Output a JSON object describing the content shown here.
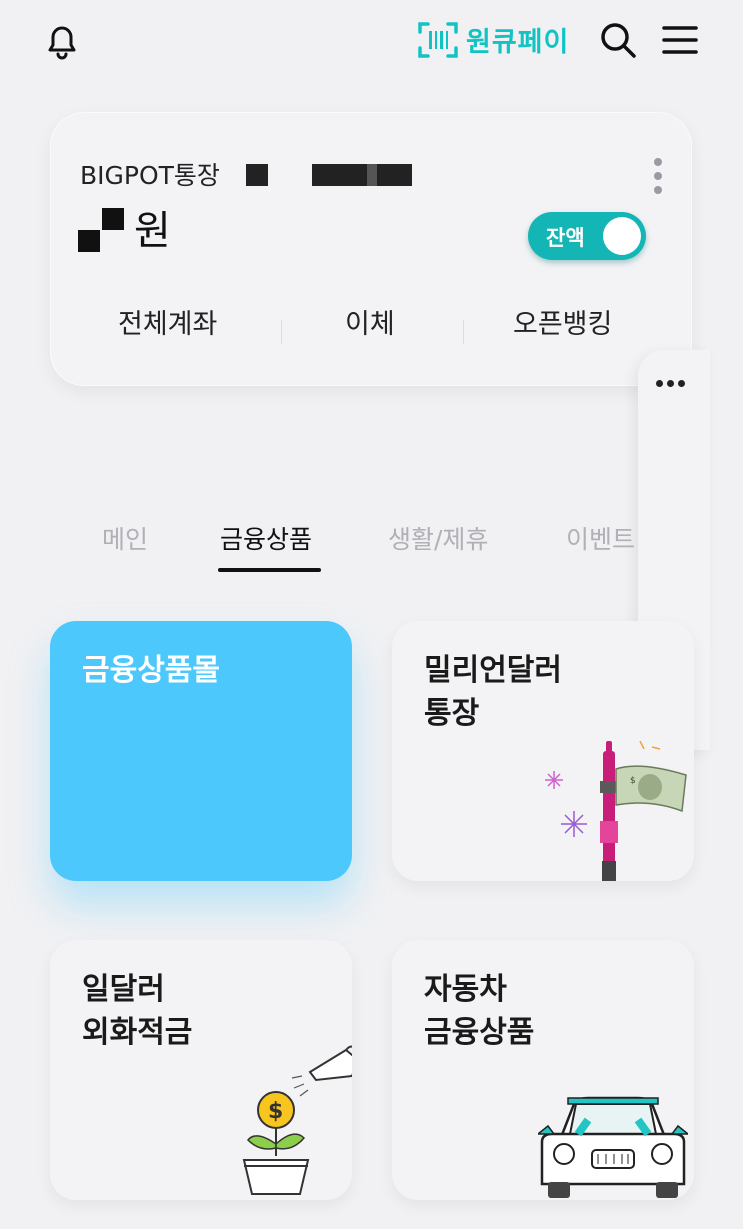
{
  "header": {
    "pay_label": "원큐페이",
    "icons": [
      "bell-icon",
      "barcode-icon",
      "search-icon",
      "menu-icon"
    ],
    "accent": "#12c3c3"
  },
  "account": {
    "name": "BIGPOT통장",
    "balance_unit": "원",
    "toggle_label": "잔액",
    "toggle_on": true,
    "actions": [
      "전체계좌",
      "이체",
      "오픈뱅킹"
    ]
  },
  "tabs": {
    "items": [
      "메인",
      "금융상품",
      "생활/제휴",
      "이벤트"
    ],
    "active_index": 1
  },
  "products": [
    {
      "title_line1": "금융상품몰",
      "title_line2": ""
    },
    {
      "title_line1": "밀리언달러",
      "title_line2": "통장"
    },
    {
      "title_line1": "일달러",
      "title_line2": "외화적금"
    },
    {
      "title_line1": "자동차",
      "title_line2": "금융상품"
    }
  ],
  "colors": {
    "highlight_card": "#4cc8fc",
    "toggle": "#13b6b5",
    "bluetooth": "#f26a2b"
  }
}
